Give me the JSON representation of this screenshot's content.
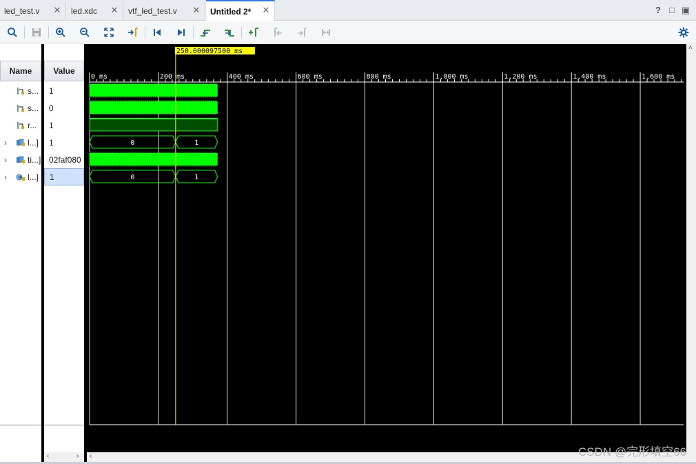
{
  "tabs": [
    {
      "label": "led_test.v",
      "active": false
    },
    {
      "label": "led.xdc",
      "active": false
    },
    {
      "label": "vtf_led_test.v",
      "active": false
    },
    {
      "label": "Untitled 2*",
      "active": true
    }
  ],
  "window_controls": {
    "help": "?",
    "restore": "□",
    "maximize": "▣"
  },
  "toolbar": {
    "buttons": [
      "search-icon",
      "save-icon",
      "zoom-in-icon",
      "zoom-out-icon",
      "zoom-fit-icon",
      "go-to-cursor-icon",
      "go-to-time-zero-icon",
      "go-to-last-time-icon",
      "previous-transition-icon",
      "next-transition-icon",
      "add-marker-icon",
      "previous-marker-icon",
      "next-marker-icon",
      "swap-cursors-icon",
      "settings-icon"
    ]
  },
  "headers": {
    "name": "Name",
    "value": "Value"
  },
  "signals": [
    {
      "name": "s...",
      "value": "1",
      "expandable": false,
      "icon": "bit-signal-icon",
      "selected": false
    },
    {
      "name": "s...",
      "value": "0",
      "expandable": false,
      "icon": "bit-signal-icon",
      "selected": false
    },
    {
      "name": "r...",
      "value": "1",
      "expandable": false,
      "icon": "bit-signal-icon",
      "selected": false
    },
    {
      "name": "l...]",
      "value": "1",
      "expandable": true,
      "icon": "bus-signal-icon",
      "selected": false
    },
    {
      "name": "ti...]",
      "value": "02faf080",
      "expandable": true,
      "icon": "bus-signal-icon",
      "selected": false
    },
    {
      "name": "l...]",
      "value": "1",
      "expandable": true,
      "icon": "bus-output-icon",
      "selected": true
    }
  ],
  "cursor": {
    "time_ms": 250.0000975,
    "label": "250.000097500 ms"
  },
  "timeline": {
    "ticks": [
      {
        "t": 0,
        "label": "0 ms"
      },
      {
        "t": 200,
        "label": "200 ms"
      },
      {
        "t": 400,
        "label": "400 ms"
      },
      {
        "t": 600,
        "label": "600 ms"
      },
      {
        "t": 800,
        "label": "800 ms"
      },
      {
        "t": 1000,
        "label": "1,000 ms"
      },
      {
        "t": 1200,
        "label": "1,200 ms"
      },
      {
        "t": 1400,
        "label": "1,400 ms"
      },
      {
        "t": 1600,
        "label": "1,600 ms"
      }
    ],
    "sim_end_ms": 372,
    "view_end_ms": 1726
  },
  "waves": [
    {
      "type": "dense"
    },
    {
      "type": "dense"
    },
    {
      "type": "high"
    },
    {
      "type": "bus",
      "segments": [
        {
          "from": 0,
          "to": 250,
          "label": "0"
        },
        {
          "from": 250,
          "to": 372,
          "label": "1"
        }
      ]
    },
    {
      "type": "dense"
    },
    {
      "type": "bus",
      "segments": [
        {
          "from": 0,
          "to": 250,
          "label": "0"
        },
        {
          "from": 250,
          "to": 372,
          "label": "1"
        }
      ]
    }
  ],
  "colors": {
    "wave_green": "#00ff00",
    "wave_dark_green": "#004d00",
    "cursor": "#ffff00",
    "grid": "#ffffff",
    "background": "#000000"
  },
  "watermark": "CSDN @完形填空66"
}
